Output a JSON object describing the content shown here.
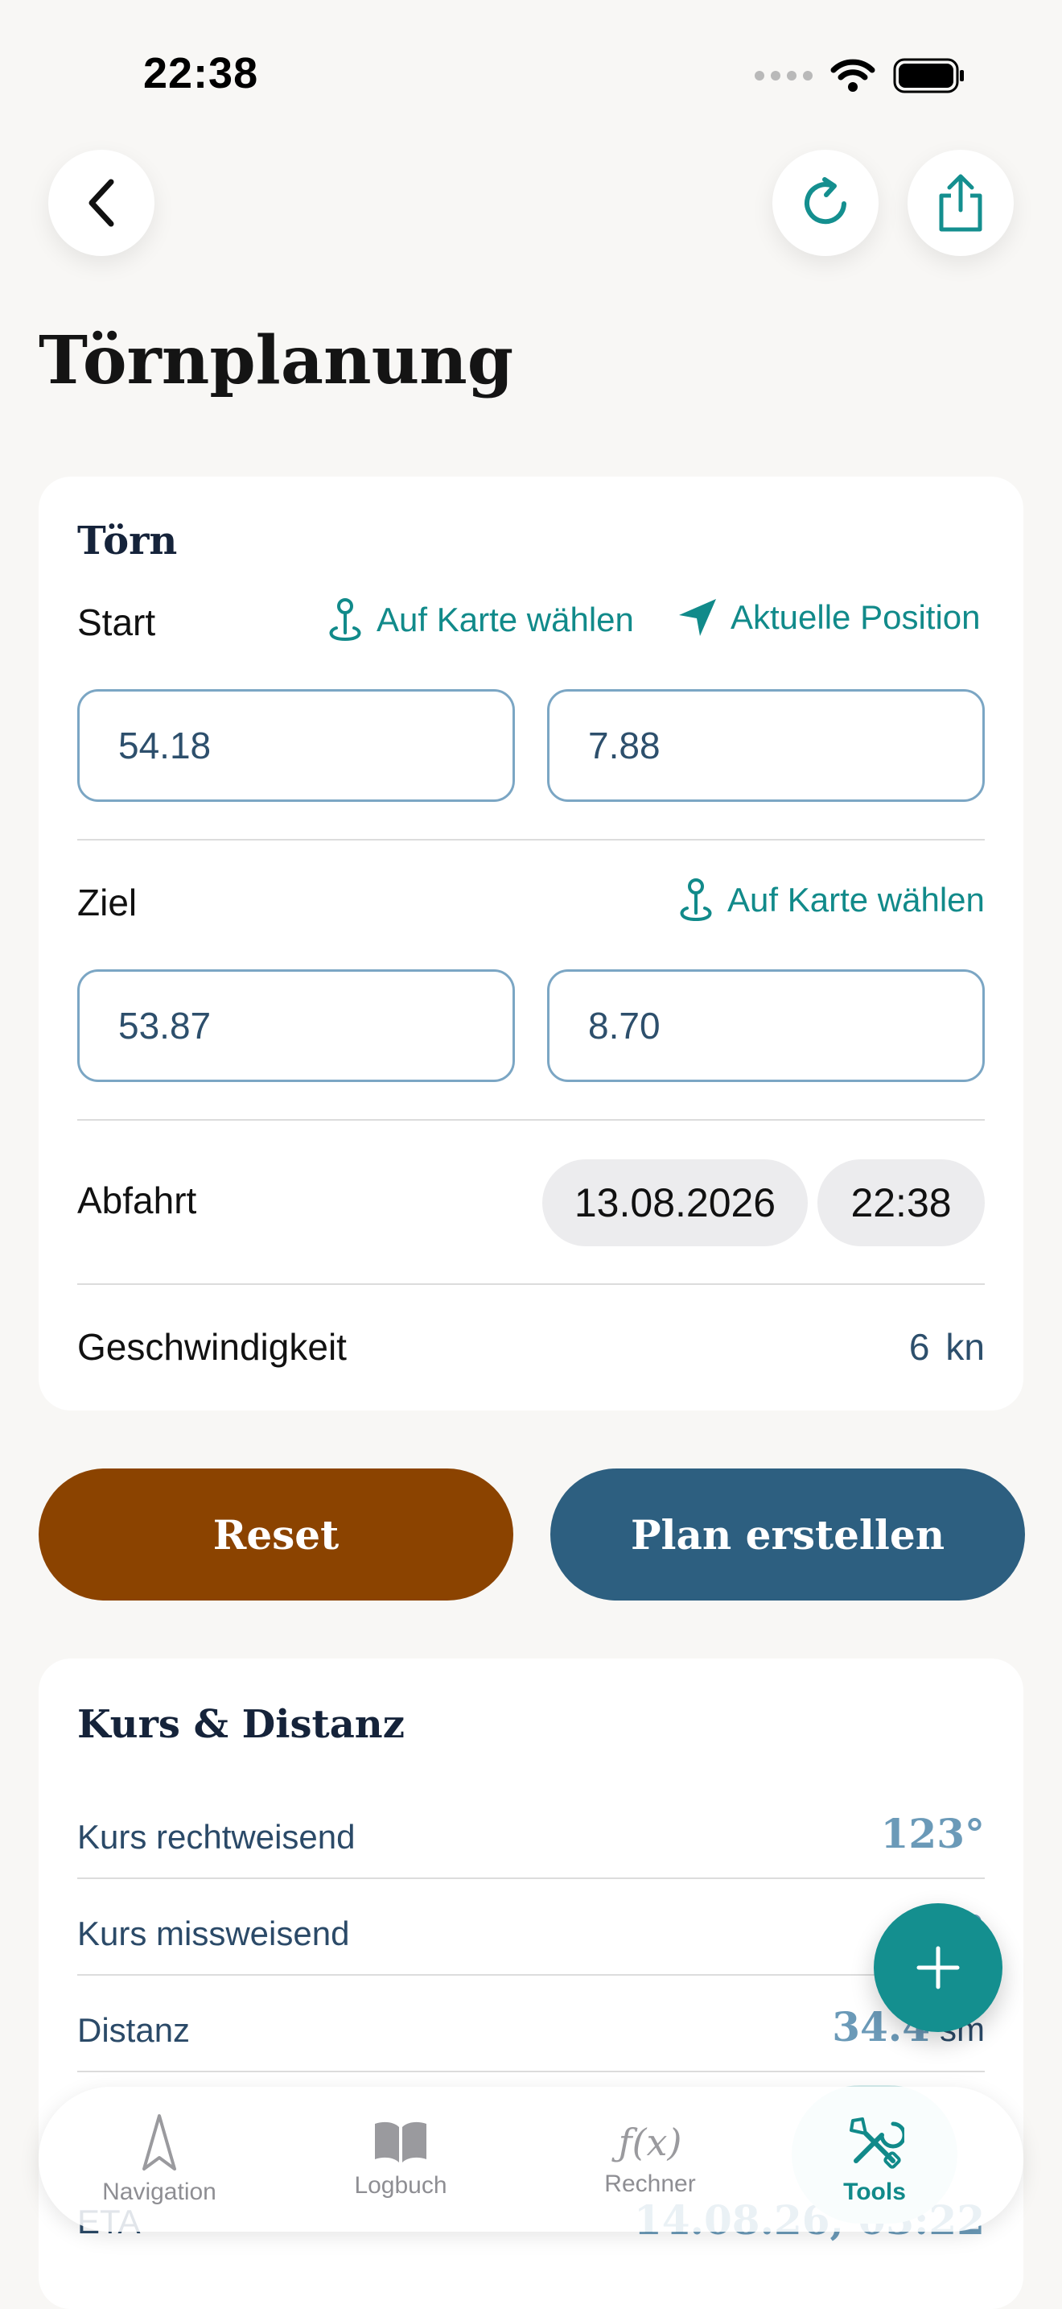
{
  "status": {
    "time": "22:38"
  },
  "header": {
    "title": "Törnplanung"
  },
  "toern": {
    "title": "Törn",
    "start_label": "Start",
    "pick_on_map": "Auf Karte wählen",
    "current_position": "Aktuelle Position",
    "start_lat": "54.18",
    "start_lon": "7.88",
    "destination_label": "Ziel",
    "dest_lat": "53.87",
    "dest_lon": "8.70",
    "departure_label": "Abfahrt",
    "departure_date": "13.08.2026",
    "departure_time": "22:38",
    "speed_label": "Geschwindigkeit",
    "speed_value": "6",
    "speed_unit": "kn"
  },
  "actions": {
    "reset": "Reset",
    "create_plan": "Plan erstellen"
  },
  "course": {
    "title": "Kurs & Distanz",
    "rows": [
      {
        "label": "Kurs rechtweisend",
        "value": "123°"
      },
      {
        "label": "Kurs missweisend",
        "value": "°"
      },
      {
        "label": "Distanz",
        "value": "34.4",
        "unit": "sm"
      },
      {
        "label": "ETA",
        "value": "14.08.26, 03:22"
      }
    ]
  },
  "tabs": [
    {
      "label": "Navigation",
      "icon": "navigation-arrow-icon"
    },
    {
      "label": "Logbuch",
      "icon": "book-icon"
    },
    {
      "label": "Rechner",
      "icon": "function-icon"
    },
    {
      "label": "Tools",
      "icon": "tools-icon",
      "active": true
    }
  ],
  "colors": {
    "accent": "#118a8a",
    "reset": "#8b4300",
    "primary": "#2d5f80"
  }
}
